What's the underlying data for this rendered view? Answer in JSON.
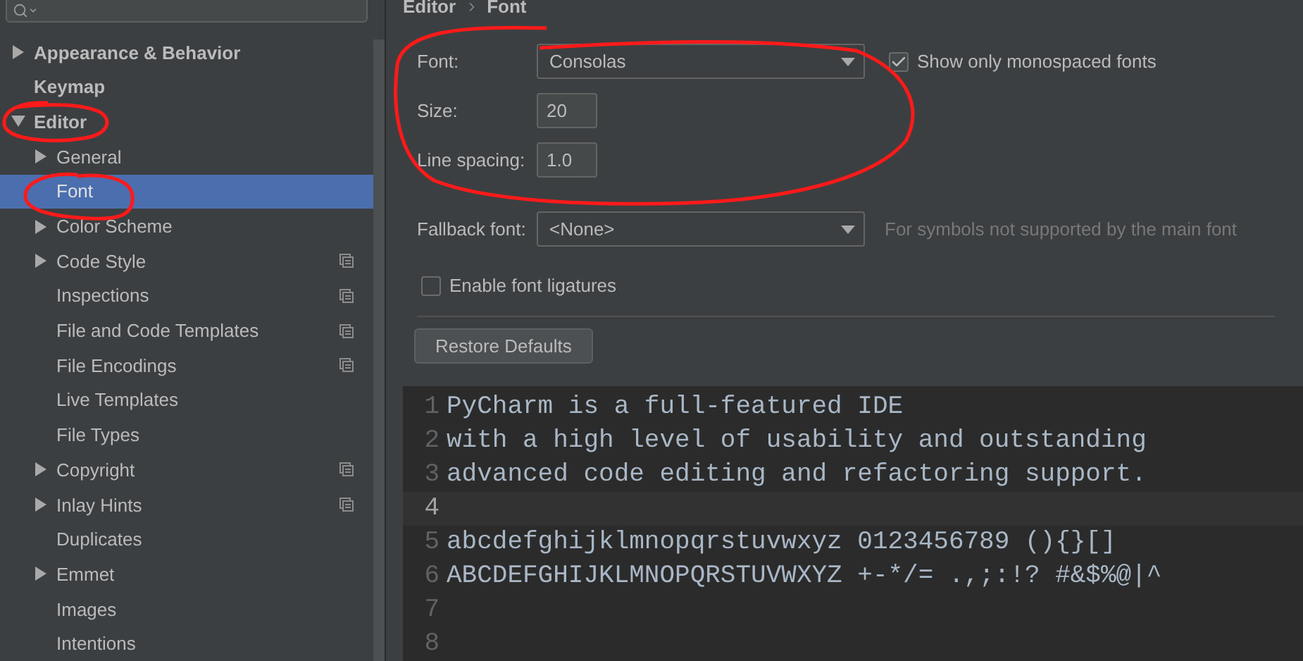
{
  "sidebar": {
    "items": [
      {
        "label": "Appearance & Behavior",
        "expanded": false,
        "selected": false,
        "project_scoped": false
      },
      {
        "label": "Keymap",
        "selected": false,
        "project_scoped": false
      },
      {
        "label": "Editor",
        "expanded": true,
        "selected": false,
        "project_scoped": false,
        "children": [
          {
            "label": "General",
            "expanded": false,
            "selected": false,
            "project_scoped": false
          },
          {
            "label": "Font",
            "selected": true,
            "project_scoped": false
          },
          {
            "label": "Color Scheme",
            "expanded": false,
            "selected": false,
            "project_scoped": false
          },
          {
            "label": "Code Style",
            "expanded": false,
            "selected": false,
            "project_scoped": true
          },
          {
            "label": "Inspections",
            "selected": false,
            "project_scoped": true
          },
          {
            "label": "File and Code Templates",
            "selected": false,
            "project_scoped": true
          },
          {
            "label": "File Encodings",
            "selected": false,
            "project_scoped": true
          },
          {
            "label": "Live Templates",
            "selected": false,
            "project_scoped": false
          },
          {
            "label": "File Types",
            "selected": false,
            "project_scoped": false
          },
          {
            "label": "Copyright",
            "expanded": false,
            "selected": false,
            "project_scoped": true
          },
          {
            "label": "Inlay Hints",
            "expanded": false,
            "selected": false,
            "project_scoped": true
          },
          {
            "label": "Duplicates",
            "selected": false,
            "project_scoped": false
          },
          {
            "label": "Emmet",
            "expanded": false,
            "selected": false,
            "project_scoped": false
          },
          {
            "label": "Images",
            "selected": false,
            "project_scoped": false
          },
          {
            "label": "Intentions",
            "selected": false,
            "project_scoped": false
          }
        ]
      }
    ]
  },
  "breadcrumb": [
    "Editor",
    "Font"
  ],
  "form": {
    "font": {
      "label": "Font:",
      "value": "Consolas"
    },
    "monospaced": {
      "label": "Show only monospaced fonts",
      "checked": true
    },
    "size": {
      "label": "Size:",
      "value": "20"
    },
    "line_spacing": {
      "label": "Line spacing:",
      "value": "1.0"
    },
    "fallback": {
      "label": "Fallback font:",
      "value": "<None>",
      "hint": "For symbols not supported by the main font"
    },
    "ligatures": {
      "label": "Enable font ligatures",
      "checked": false
    },
    "restore_button": "Restore Defaults"
  },
  "preview": {
    "lines": [
      {
        "number": "1",
        "text": "PyCharm is a full-featured IDE",
        "current": false
      },
      {
        "number": "2",
        "text": "with a high level of usability and outstanding",
        "current": false
      },
      {
        "number": "3",
        "text": "advanced code editing and refactoring support.",
        "current": false
      },
      {
        "number": "4",
        "current": true
      },
      {
        "number": "5",
        "text": "abcdefghijklmnopqrstuvwxyz 0123456789 (){}[]",
        "current": false
      },
      {
        "number": "6",
        "text": "ABCDEFGHIJKLMNOPQRSTUVWXYZ +-*/= .,;:!? #&$%@|^",
        "current": false
      },
      {
        "number": "7",
        "current": false
      },
      {
        "number": "8",
        "current": false
      }
    ]
  }
}
